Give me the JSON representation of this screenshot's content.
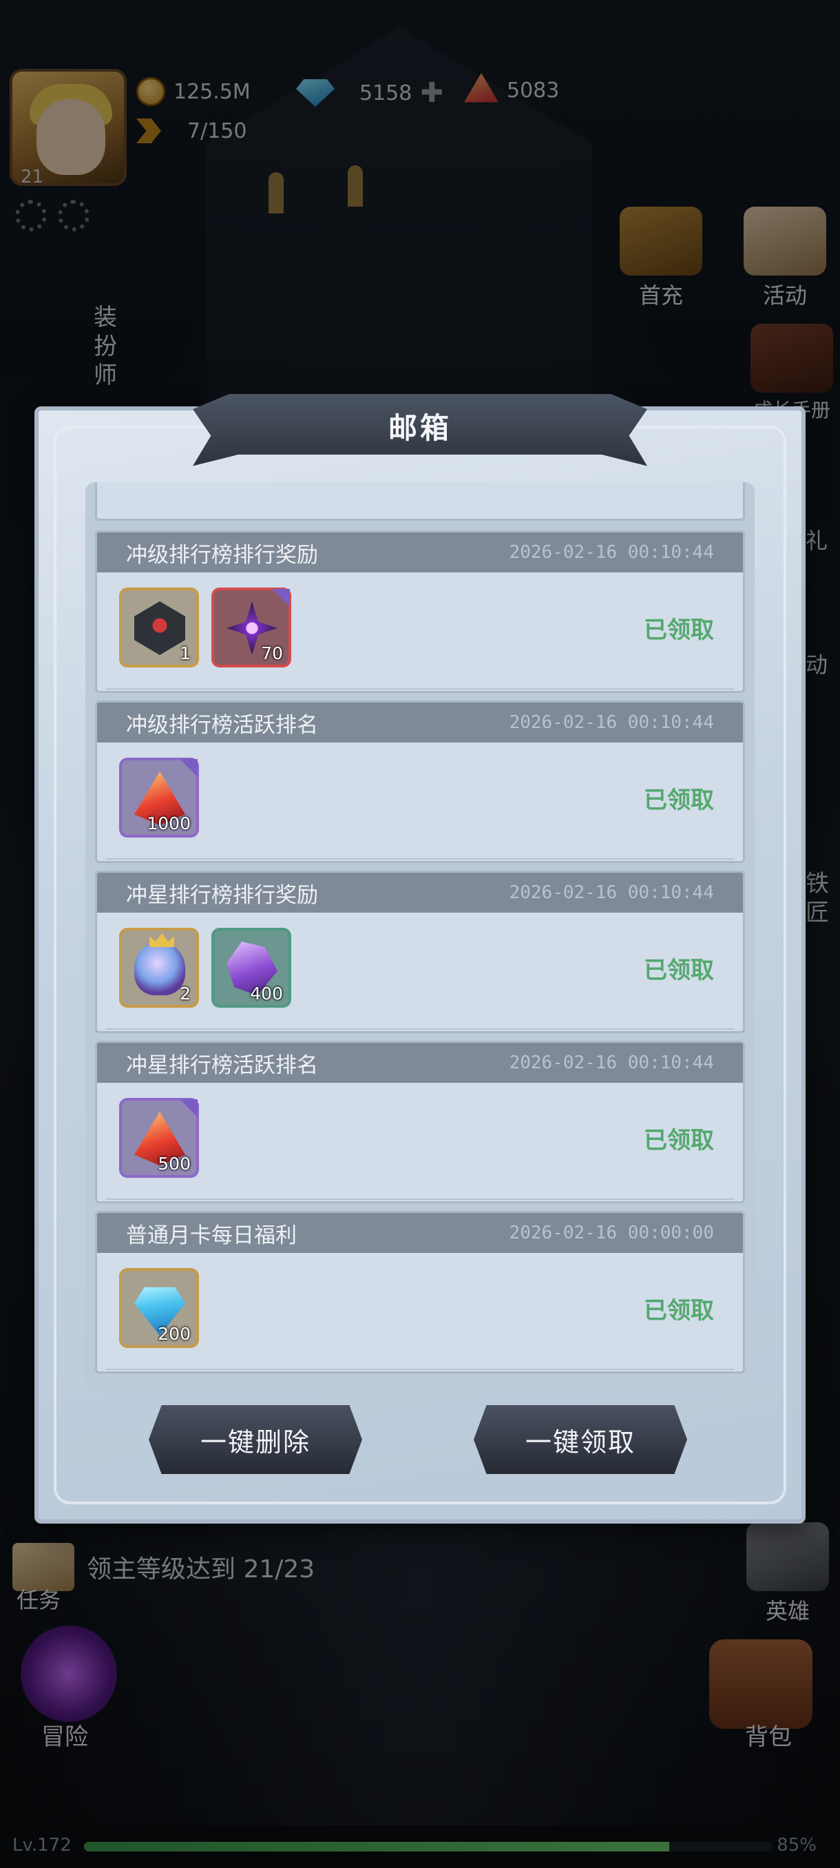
{
  "hud": {
    "avatar_level": "21",
    "gold": "125.5M",
    "diamonds": "5158",
    "red_gems": "5083",
    "stamina": "7/150"
  },
  "side_menu": {
    "first_charge": "首充",
    "activity": "活动",
    "dresser": "装扮师",
    "growth_manual": "成长手册",
    "gift_partial": "有礼",
    "activity_partial": "活动",
    "blacksmith": "铁匠",
    "hero": "英雄",
    "backpack": "背包",
    "adventure": "冒险"
  },
  "task": {
    "label": "任务",
    "text": "领主等级达到 21/23"
  },
  "player": {
    "level_text": "Lv.172",
    "xp_percent_text": "85%",
    "xp_fraction": 0.85
  },
  "mailbox": {
    "title": "邮箱",
    "mails": [
      {
        "title": "冲级排行榜排行奖励",
        "date": "2026-02-16 00:10:44",
        "status": "已领取",
        "items": [
          {
            "icon": "dice-icon",
            "qty": "1",
            "rarity": "gold"
          },
          {
            "icon": "purple-shuriken-icon",
            "qty": "70",
            "rarity": "red"
          }
        ]
      },
      {
        "title": "冲级排行榜活跃排名",
        "date": "2026-02-16 00:10:44",
        "status": "已领取",
        "items": [
          {
            "icon": "red-gem-icon",
            "qty": "1000",
            "rarity": "purple"
          }
        ]
      },
      {
        "title": "冲星排行榜排行奖励",
        "date": "2026-02-16 00:10:44",
        "status": "已领取",
        "items": [
          {
            "icon": "crowned-orb-icon",
            "qty": "2",
            "rarity": "gold"
          },
          {
            "icon": "purple-crystal-icon",
            "qty": "400",
            "rarity": "green"
          }
        ]
      },
      {
        "title": "冲星排行榜活跃排名",
        "date": "2026-02-16 00:10:44",
        "status": "已领取",
        "items": [
          {
            "icon": "red-gem-icon",
            "qty": "500",
            "rarity": "purple"
          }
        ]
      },
      {
        "title": "普通月卡每日福利",
        "date": "2026-02-16 00:00:00",
        "status": "已领取",
        "items": [
          {
            "icon": "diamond-icon",
            "qty": "200",
            "rarity": "gold"
          }
        ]
      }
    ],
    "delete_all": "一键删除",
    "claim_all": "一键领取"
  },
  "colors": {
    "claimed_green": "#54a86e",
    "panel_bg": "#c6d3e1",
    "mail_header": "#7f8a98"
  }
}
